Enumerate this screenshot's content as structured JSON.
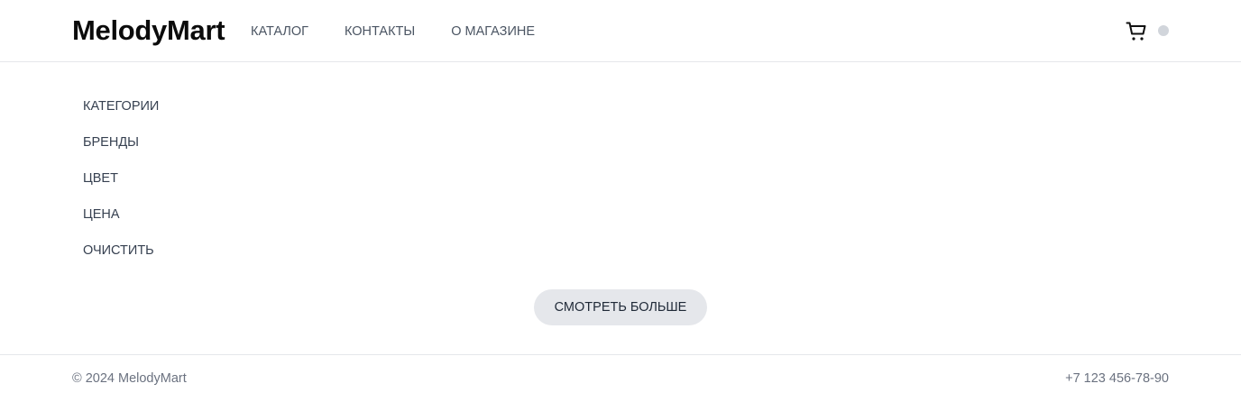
{
  "header": {
    "logo": "MelodyMart",
    "nav": [
      {
        "label": "КАТАЛОГ"
      },
      {
        "label": "КОНТАКТЫ"
      },
      {
        "label": "О МАГАЗИНЕ"
      }
    ],
    "cart_icon": "cart-icon",
    "status_dot_color": "#d1d5db"
  },
  "filters": {
    "items": [
      {
        "label": "КАТЕГОРИИ"
      },
      {
        "label": "БРЕНДЫ"
      },
      {
        "label": "ЦВЕТ"
      },
      {
        "label": "ЦЕНА"
      },
      {
        "label": "ОЧИСТИТЬ"
      }
    ]
  },
  "main": {
    "more_button_label": "СМОТРЕТЬ БОЛЬШЕ"
  },
  "footer": {
    "copyright": "© 2024 MelodyMart",
    "phone": "+7 123 456-78-90"
  }
}
